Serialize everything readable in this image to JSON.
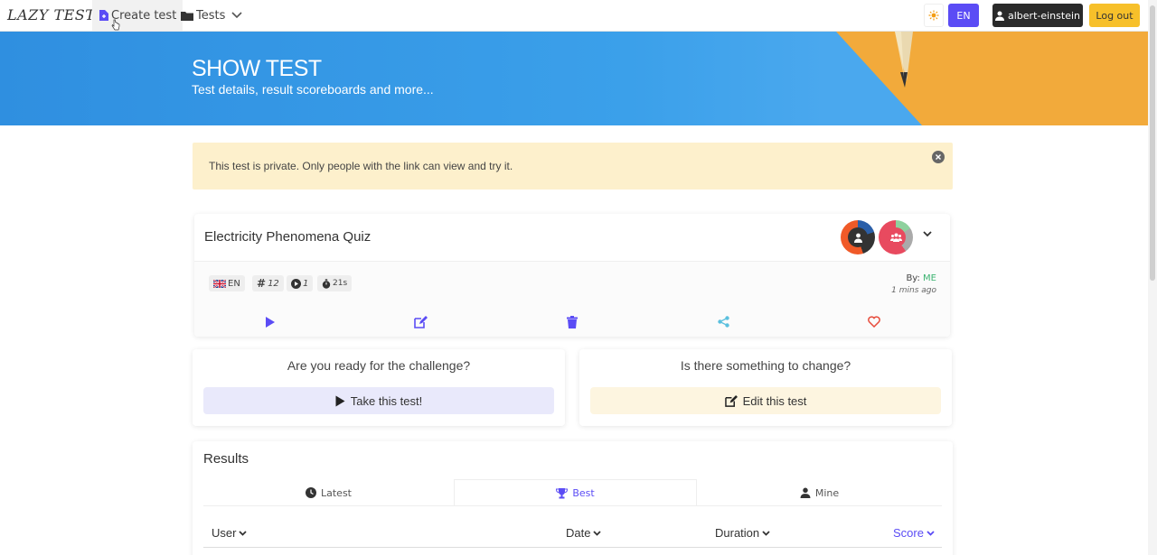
{
  "nav": {
    "logo": "LAZY TEST",
    "create_test": "Create test",
    "tests": "Tests",
    "lang": "EN",
    "user": "albert-einstein",
    "logout": "Log out"
  },
  "hero": {
    "title": "SHOW TEST",
    "subtitle": "Test details, result scoreboards and more..."
  },
  "alert": {
    "text": "This test is private. Only people with the link can view and try it."
  },
  "test": {
    "title": "Electricity Phenomena Quiz",
    "tags": {
      "lang": "EN",
      "questions": "12",
      "plays": "1",
      "duration": "21s"
    },
    "by_label": "By:",
    "author": "ME",
    "ago": "1 mins ago"
  },
  "challenge": {
    "left_question": "Are you ready for the challenge?",
    "left_button": "Take this test!",
    "right_question": "Is there something to change?",
    "right_button": "Edit this test"
  },
  "results": {
    "title": "Results",
    "tabs": [
      "Latest",
      "Best",
      "Mine"
    ],
    "active_tab": "Best",
    "columns": [
      "User",
      "Date",
      "Duration",
      "Score"
    ]
  },
  "colors": {
    "accent": "#5b4cf5",
    "logout": "#f7c02a",
    "alert_bg": "#fdf0cc",
    "hero_blue": "#3ba0ea",
    "hero_yellow": "#f2aa3b",
    "delete_icon": "#5b4cf5",
    "share_icon": "#5bc0de",
    "heart_icon": "#e74c3c"
  },
  "icons": {
    "create": "file-plus-icon",
    "tests": "folder-icon",
    "theme": "sun-icon",
    "user": "user-tie-icon",
    "play": "play-icon",
    "edit": "edit-icon",
    "delete": "trash-icon",
    "share": "share-icon",
    "favorite": "heart-icon",
    "latest": "clock-icon",
    "best": "trophy-icon",
    "mine": "user-tie-icon"
  }
}
